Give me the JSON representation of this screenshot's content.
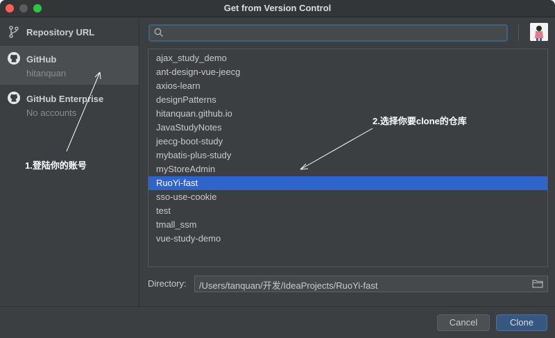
{
  "window": {
    "title": "Get from Version Control"
  },
  "sidebar": {
    "items": [
      {
        "label": "Repository URL",
        "icon": "branch-icon"
      },
      {
        "label": "GitHub",
        "sublabel": "hitanquan",
        "icon": "github-icon",
        "selected": true
      },
      {
        "label": "GitHub Enterprise",
        "sublabel": "No accounts",
        "icon": "github-icon"
      }
    ]
  },
  "search": {
    "placeholder": "",
    "value": ""
  },
  "repos": [
    "ajax_study_demo",
    "ant-design-vue-jeecg",
    "axios-learn",
    "designPatterns",
    "hitanquan.github.io",
    "JavaStudyNotes",
    "jeecg-boot-study",
    "mybatis-plus-study",
    "myStoreAdmin",
    "RuoYi-fast",
    "sso-use-cookie",
    "test",
    "tmall_ssm",
    "vue-study-demo"
  ],
  "selected_repo": "RuoYi-fast",
  "directory": {
    "label": "Directory:",
    "value": "/Users/tanquan/开发/IdeaProjects/RuoYi-fast"
  },
  "buttons": {
    "cancel": "Cancel",
    "clone": "Clone"
  },
  "annotations": {
    "login": "1.登陆你的账号",
    "choose": "2.选择你要clone的仓库"
  },
  "colors": {
    "selection": "#2f65ca",
    "clone_button": "#365880",
    "background": "#3c3f41"
  }
}
